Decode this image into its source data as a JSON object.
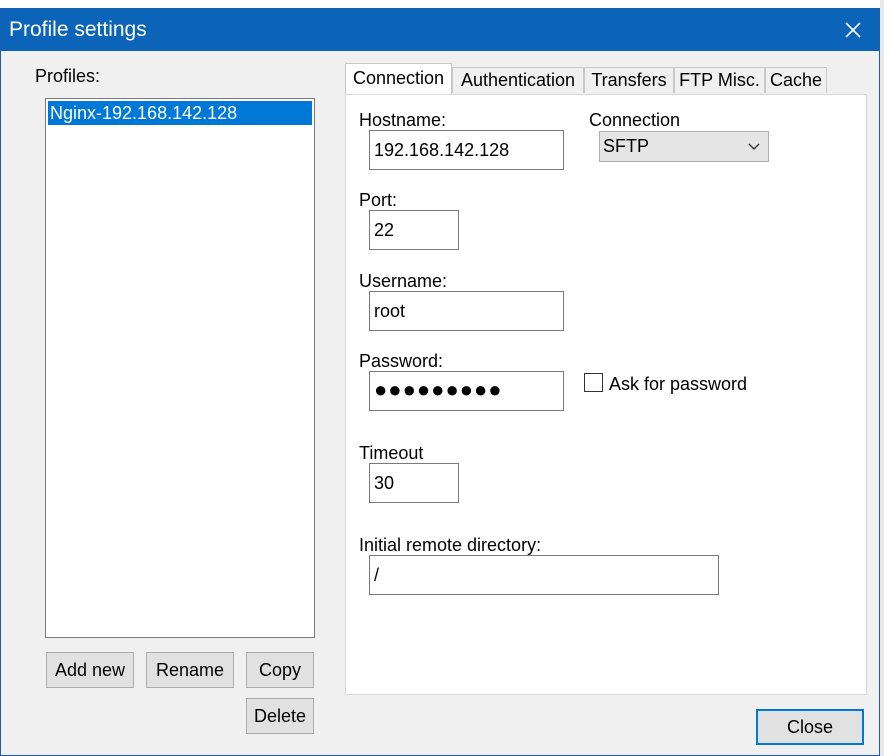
{
  "dialog": {
    "title": "Profile settings"
  },
  "profiles": {
    "label": "Profiles:",
    "items": [
      "Nginx-192.168.142.128"
    ]
  },
  "buttons": {
    "add_new": "Add new",
    "rename": "Rename",
    "copy": "Copy",
    "delete": "Delete",
    "close": "Close"
  },
  "tabs": [
    "Connection",
    "Authentication",
    "Transfers",
    "FTP Misc.",
    "Cache"
  ],
  "form": {
    "hostname_label": "Hostname:",
    "hostname_value": "192.168.142.128",
    "connection_label": "Connection",
    "connection_value": "SFTP",
    "port_label": "Port:",
    "port_value": "22",
    "username_label": "Username:",
    "username_value": "root",
    "password_label": "Password:",
    "password_value": "●●●●●●●●●",
    "ask_password_label": "Ask for password",
    "timeout_label": "Timeout",
    "timeout_value": "30",
    "remote_dir_label": "Initial remote directory:",
    "remote_dir_value": "/"
  },
  "icons": {
    "close": "close-icon",
    "dropdown": "chevron-down-icon"
  },
  "colors": {
    "titlebar": "#0b64b8",
    "selection": "#0078d7",
    "dialog_bg": "#f0f0f0"
  }
}
